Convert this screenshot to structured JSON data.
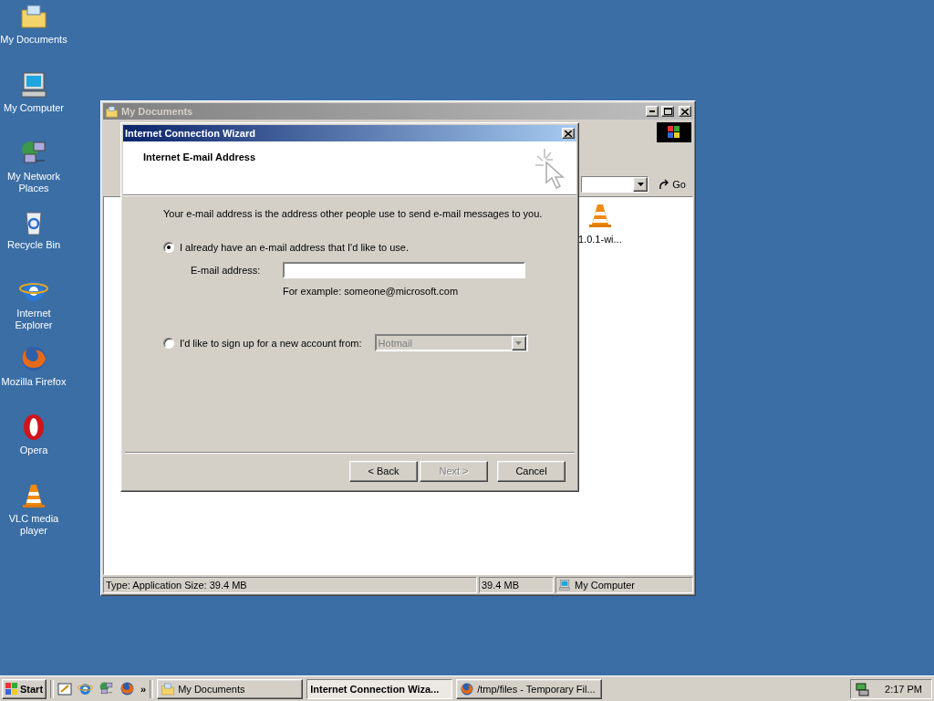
{
  "desktop_icons": [
    {
      "label": "My Documents",
      "kind": "folder"
    },
    {
      "label": "My Computer",
      "kind": "computer"
    },
    {
      "label": "My Network Places",
      "kind": "network"
    },
    {
      "label": "Recycle Bin",
      "kind": "bin"
    },
    {
      "label": "Internet Explorer",
      "kind": "ie"
    },
    {
      "label": "Mozilla Firefox",
      "kind": "firefox"
    },
    {
      "label": "Opera",
      "kind": "opera"
    },
    {
      "label": "VLC media player",
      "kind": "vlc"
    }
  ],
  "explorer_window": {
    "title": "My Documents",
    "go_button": "Go",
    "file_label": "1.0.1-wi...",
    "status_bar": [
      "Type: Application Size: 39.4 MB",
      "39.4 MB",
      "My Computer"
    ]
  },
  "wizard": {
    "title": "Internet Connection Wizard",
    "heading": "Internet E-mail Address",
    "intro": "Your e-mail address is the address other people use to send e-mail messages to you.",
    "options": [
      {
        "label": "I already have an e-mail address that I'd like to use.",
        "selected": true
      },
      {
        "label": "I'd like to sign up for a new account from:",
        "selected": false
      }
    ],
    "email_label": "E-mail address:",
    "example": "For example: someone@microsoft.com",
    "provider": {
      "value": "Hotmail",
      "disabled": true
    },
    "buttons": [
      {
        "label": "< Back",
        "disabled": false
      },
      {
        "label": "Next >",
        "disabled": true
      },
      {
        "label": "Cancel",
        "disabled": false
      }
    ]
  },
  "taskbar": {
    "start": "Start",
    "more": "»",
    "tasks": [
      {
        "label": "My Documents",
        "selected": false,
        "kind": "folder"
      },
      {
        "label": "Internet Connection Wiza...",
        "selected": true,
        "kind": "none"
      },
      {
        "label": "/tmp/files - Temporary Fil...",
        "selected": false,
        "kind": "firefox"
      }
    ],
    "clock": "2:17 PM"
  }
}
